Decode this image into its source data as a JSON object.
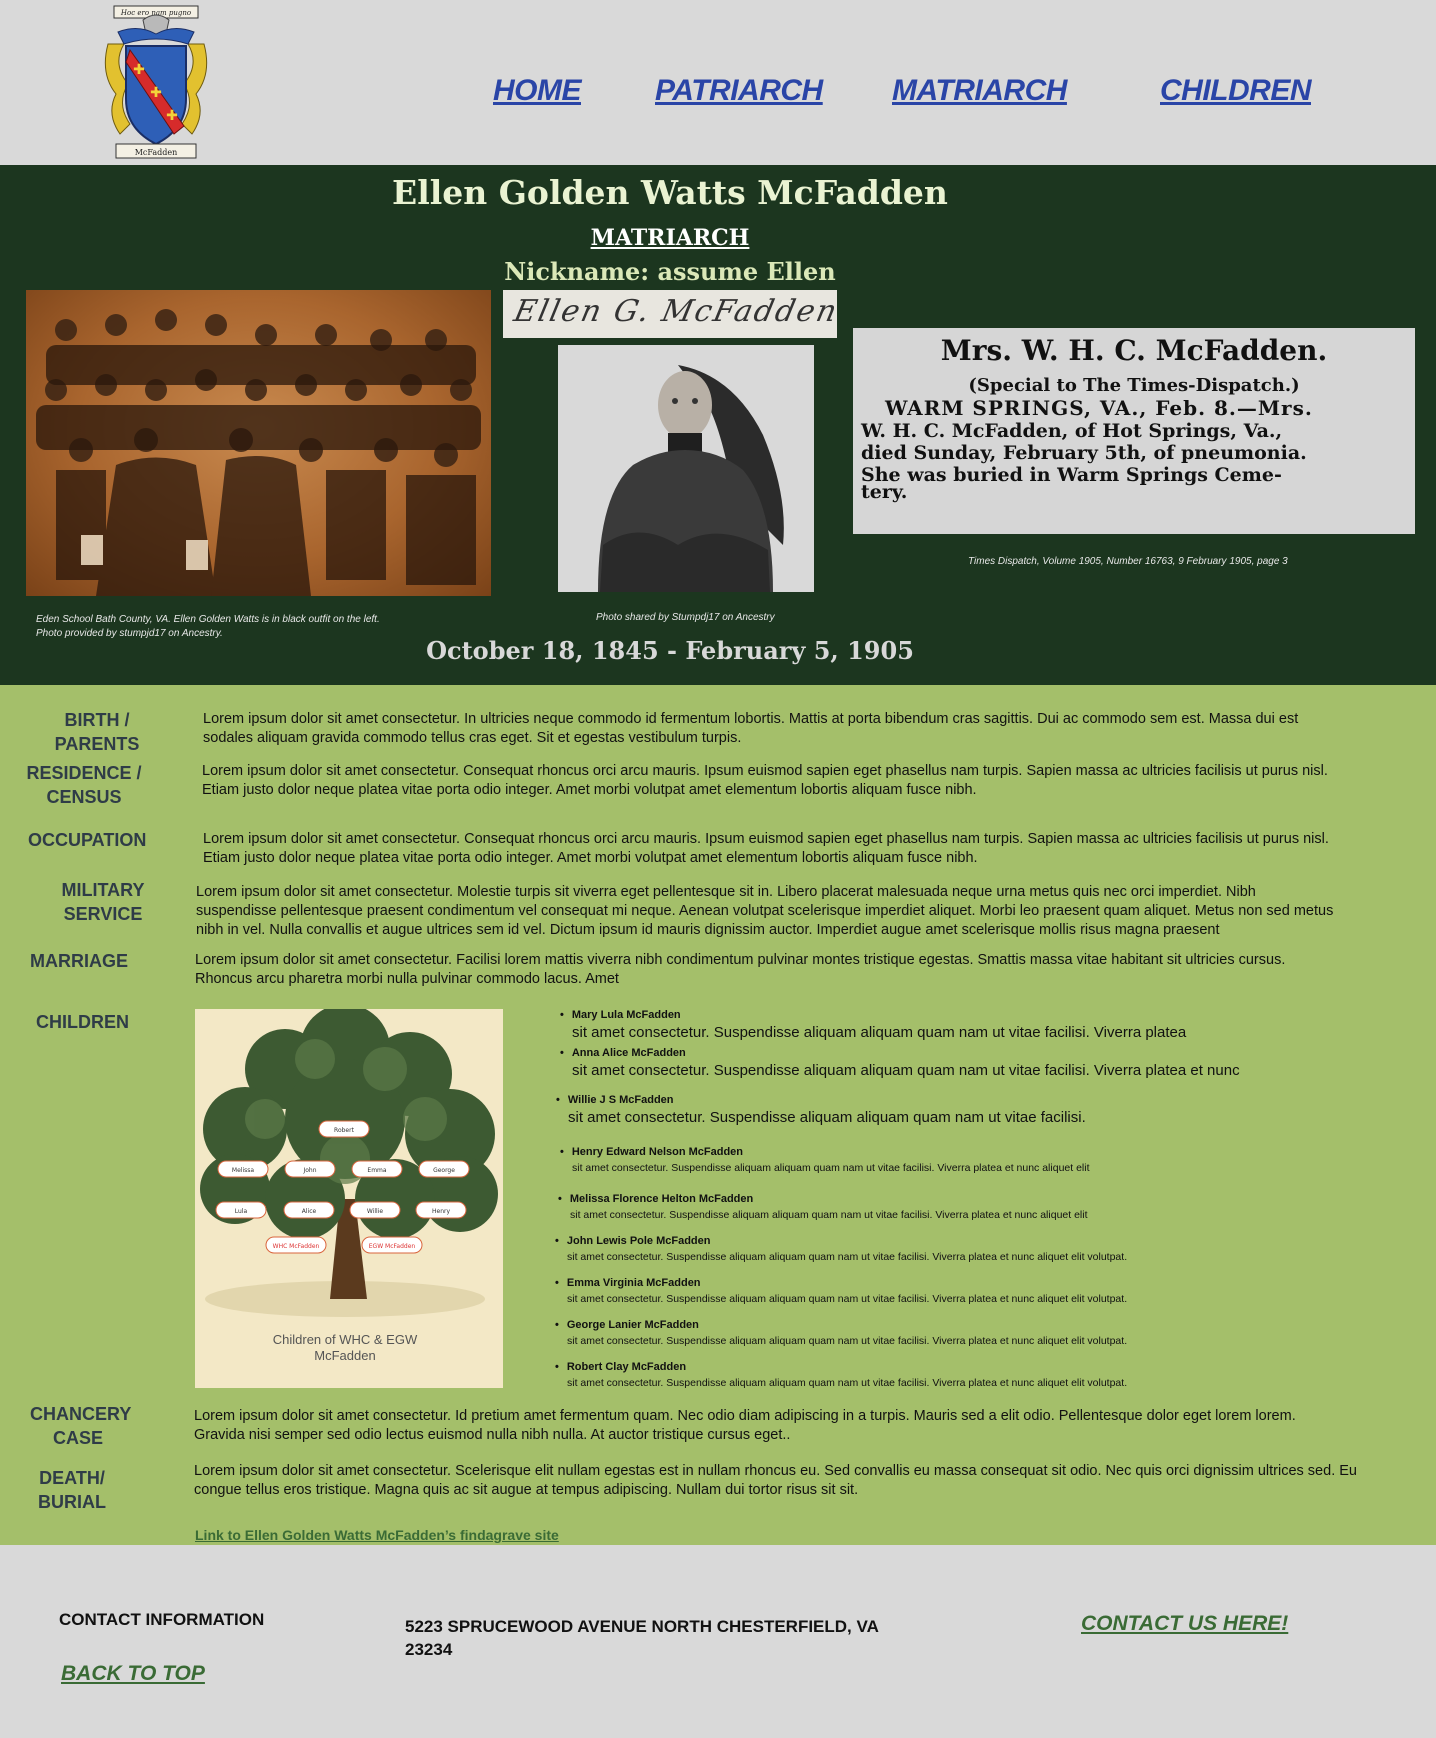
{
  "crest": {
    "motto": "Hoc ero nam pugno",
    "family": "McFadden"
  },
  "nav": {
    "home": "HOME",
    "patriarch": "PATRIARCH",
    "matriarch": "MATRIARCH",
    "children": "CHILDREN",
    "link_color": "#2a45a7"
  },
  "hero": {
    "name": "Ellen Golden Watts McFadden",
    "role": "MATRIARCH",
    "nickname": "Nickname:  assume Ellen",
    "signature": "Ellen G. McFadden",
    "dates": "October 18, 1845 - February 5, 1905",
    "bg_color": "#1c361f",
    "school_caption_1": "Eden School Bath County, VA.  Ellen Golden Watts is in black outfit on the left.",
    "school_caption_2": "Photo provided by stumpjd17 on Ancestry.",
    "portrait_caption": "Photo shared by Stumpdj17 on Ancestry",
    "clipping": {
      "headline": "Mrs. W. H. C. McFadden.",
      "line1": "(Special to The Times-Dispatch.)",
      "line2": "WARM SPRINGS, VA., Feb. 8.—Mrs.",
      "line3": "W. H. C. McFadden, of Hot Springs, Va.,",
      "line4": "died Sunday, February 5th, of pneumonia.",
      "line5": "She was buried in Warm Springs Ceme-",
      "line6": "tery."
    },
    "clipping_caption": "Times Dispatch, Volume 1905, Number 16763,  9 February 1905, page 3"
  },
  "sections": {
    "birth": {
      "label_1": "BIRTH / PARENTS",
      "text": "Lorem ipsum dolor sit amet consectetur. In ultricies neque commodo id fermentum lobortis. Mattis at porta bibendum cras sagittis. Dui ac commodo sem est. Massa dui est sodales aliquam gravida commodo tellus cras eget. Sit et egestas vestibulum turpis."
    },
    "residence": {
      "label_1": "RESIDENCE /",
      "label_2": "CENSUS",
      "text": "Lorem ipsum dolor sit amet consectetur. Consequat rhoncus orci arcu mauris. Ipsum euismod sapien eget phasellus nam turpis. Sapien massa ac ultricies facilisis ut purus nisl. Etiam justo dolor neque platea vitae porta odio integer. Amet morbi volutpat amet elementum lobortis aliquam fusce nibh."
    },
    "occupation": {
      "label_1": "OCCUPATION",
      "text": "Lorem ipsum dolor sit amet consectetur. Consequat rhoncus orci arcu mauris. Ipsum euismod sapien eget phasellus nam turpis. Sapien massa ac ultricies facilisis ut purus nisl. Etiam justo dolor neque platea vitae porta odio integer. Amet morbi volutpat amet elementum lobortis aliquam fusce nibh."
    },
    "military": {
      "label_1": "MILITARY SERVICE",
      "text": "Lorem ipsum dolor sit amet consectetur. Molestie turpis sit viverra eget pellentesque sit in. Libero placerat malesuada neque urna metus quis nec orci imperdiet. Nibh suspendisse pellentesque praesent condimentum vel consequat mi neque. Aenean volutpat scelerisque imperdiet aliquet. Morbi leo praesent quam aliquet. Metus non sed metus nibh in vel. Nulla convallis et augue ultrices sem id vel. Dictum ipsum id mauris dignissim auctor. Imperdiet augue amet scelerisque mollis risus magna praesent"
    },
    "marriage": {
      "label_1": "MARRIAGE",
      "text": "Lorem ipsum dolor sit amet consectetur. Facilisi lorem mattis viverra nibh condimentum pulvinar montes tristique egestas. Smattis massa vitae habitant sit ultricies cursus. Rhoncus arcu pharetra morbi nulla pulvinar commodo lacus. Amet"
    },
    "children": {
      "label_1": "CHILDREN"
    },
    "chancery": {
      "label_1": "CHANCERY",
      "label_2": "CASE",
      "text": "Lorem ipsum dolor sit amet consectetur. Id pretium amet fermentum quam. Nec odio diam adipiscing in a turpis. Mauris sed a elit odio. Pellentesque dolor eget lorem lorem. Gravida nisi semper sed odio lectus euismod nulla nibh nulla. At auctor tristique cursus eget.."
    },
    "death": {
      "label_1": "DEATH/",
      "label_2": "BURIAL",
      "text": "Lorem ipsum dolor sit amet consectetur. Scelerisque elit nullam egestas est in nullam rhoncus eu. Sed convallis eu massa consequat sit odio. Nec quis orci dignissim ultrices sed. Eu congue tellus eros tristique. Magna quis ac sit augue at tempus adipiscing. Nullam dui tortor risus sit sit."
    }
  },
  "tree": {
    "caption_1": "Children of WHC & EGW",
    "caption_2": "McFadden",
    "root": "Robert",
    "row1": [
      "Melissa",
      "John",
      "Emma",
      "George"
    ],
    "row2": [
      "Lula",
      "Alice",
      "Willie",
      "Henry"
    ],
    "row3": [
      "WHC McFadden",
      "EGW McFadden"
    ]
  },
  "children_list": [
    {
      "name": "Mary  Lula McFadden",
      "desc": "sit amet consectetur. Suspendisse aliquam aliquam quam nam ut vitae facilisi. Viverra platea"
    },
    {
      "name": "Anna Alice McFadden",
      "desc": "sit amet consectetur. Suspendisse aliquam aliquam quam nam ut vitae facilisi. Viverra platea et nunc"
    },
    {
      "name": "Willie J S McFadden",
      "desc": "sit amet consectetur. Suspendisse aliquam aliquam quam nam ut vitae facilisi."
    },
    {
      "name": "Henry Edward Nelson McFadden",
      "desc": "sit amet consectetur. Suspendisse aliquam aliquam quam nam ut vitae facilisi. Viverra platea et nunc aliquet elit"
    },
    {
      "name": "Melissa Florence Helton McFadden",
      "desc": "sit amet consectetur. Suspendisse aliquam aliquam quam nam ut vitae facilisi. Viverra platea et nunc aliquet elit"
    },
    {
      "name": "John Lewis Pole McFadden",
      "desc": "sit amet consectetur. Suspendisse aliquam aliquam quam nam ut vitae facilisi. Viverra platea et nunc aliquet elit volutpat."
    },
    {
      "name": "Emma Virginia McFadden",
      "desc": "sit amet consectetur. Suspendisse aliquam aliquam quam nam ut vitae facilisi. Viverra platea et nunc aliquet elit volutpat."
    },
    {
      "name": "George Lanier McFadden",
      "desc": "sit amet consectetur. Suspendisse aliquam aliquam quam nam ut vitae facilisi. Viverra platea et nunc aliquet elit volutpat."
    },
    {
      "name": "Robert Clay McFadden",
      "desc": "sit amet consectetur. Suspendisse aliquam aliquam quam nam ut vitae facilisi. Viverra platea et nunc aliquet elit volutpat."
    }
  ],
  "findagrave_link": "Link to Ellen Golden Watts McFadden’s findagrave site",
  "footer": {
    "contact_heading": "CONTACT INFORMATION",
    "address_1": "5223 SPRUCEWOOD AVENUE NORTH CHESTERFIELD, VA",
    "address_2": "23234",
    "contact_link": "CONTACT US HERE!",
    "back_to_top": "BACK TO TOP",
    "link_color": "#3a6b35"
  }
}
